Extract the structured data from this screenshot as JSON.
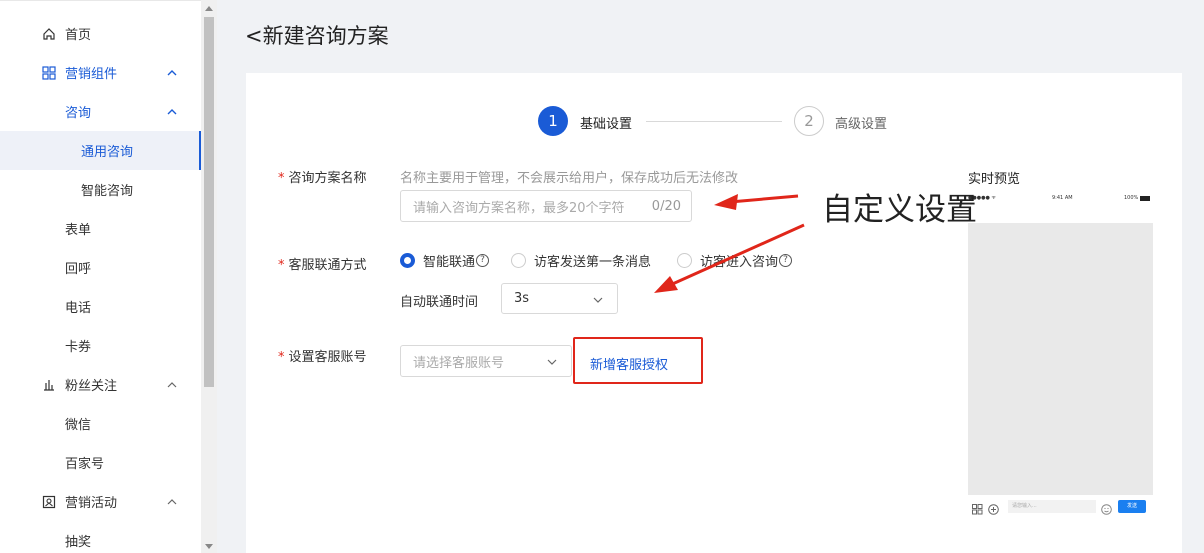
{
  "sidebar": {
    "items": [
      {
        "label": "首页",
        "icon": "home-icon"
      },
      {
        "label": "营销组件",
        "icon": "grid-icon"
      },
      {
        "label": "咨询"
      },
      {
        "label": "通用咨询"
      },
      {
        "label": "智能咨询"
      },
      {
        "label": "表单"
      },
      {
        "label": "回呼"
      },
      {
        "label": "电话"
      },
      {
        "label": "卡券"
      },
      {
        "label": "粉丝关注",
        "icon": "bar-chart-icon"
      },
      {
        "label": "微信"
      },
      {
        "label": "百家号"
      },
      {
        "label": "营销活动",
        "icon": "activity-icon"
      },
      {
        "label": "抽奖"
      }
    ]
  },
  "header": {
    "title": "<新建咨询方案"
  },
  "steps": [
    {
      "number": "1",
      "label": "基础设置"
    },
    {
      "number": "2",
      "label": "高级设置"
    }
  ],
  "form": {
    "name": {
      "label": "咨询方案名称",
      "hint": "名称主要用于管理，不会展示给用户，保存成功后无法修改",
      "placeholder": "请输入咨询方案名称，最多20个字符",
      "counter": "0/20"
    },
    "connect": {
      "label": "客服联通方式",
      "options": [
        "智能联通",
        "访客发送第一条消息",
        "访客进入咨询"
      ],
      "selected": "智能联通",
      "auto_label": "自动联通时间",
      "auto_value": "3s"
    },
    "account": {
      "label": "设置客服账号",
      "placeholder": "请选择客服账号",
      "add_link": "新增客服授权"
    }
  },
  "preview": {
    "title": "实时预览",
    "status_time": "9:41 AM",
    "battery": "100%",
    "input_placeholder": "请您输入...",
    "send": "发送"
  },
  "annotation": {
    "text": "自定义设置"
  },
  "colors": {
    "primary": "#1a5bd6",
    "required": "#e0261a",
    "annotation": "#e0261a"
  }
}
